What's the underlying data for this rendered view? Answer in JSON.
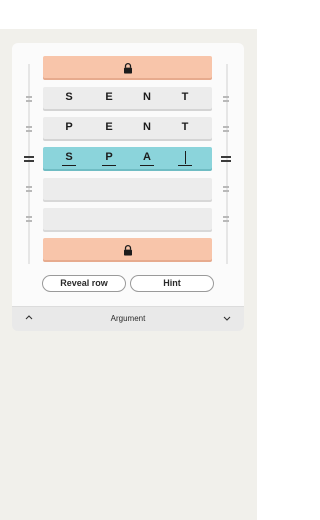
{
  "board": {
    "rows": [
      {
        "kind": "locked",
        "icon": "lock-icon"
      },
      {
        "kind": "word",
        "letters": [
          "S",
          "E",
          "N",
          "T"
        ]
      },
      {
        "kind": "word",
        "letters": [
          "P",
          "E",
          "N",
          "T"
        ]
      },
      {
        "kind": "active",
        "letters": [
          "S",
          "P",
          "A",
          ""
        ]
      },
      {
        "kind": "empty"
      },
      {
        "kind": "empty"
      },
      {
        "kind": "locked",
        "icon": "lock-icon"
      }
    ]
  },
  "buttons": {
    "reveal_row": "Reveal row",
    "hint": "Hint"
  },
  "footer": {
    "label": "Argument",
    "left_icon": "chevron-up-icon",
    "right_icon": "chevron-down-icon"
  },
  "colors": {
    "locked_row": "#f8c5aa",
    "active_row": "#8bd4db",
    "word_row": "#ececec",
    "background": "#f1f0eb"
  }
}
